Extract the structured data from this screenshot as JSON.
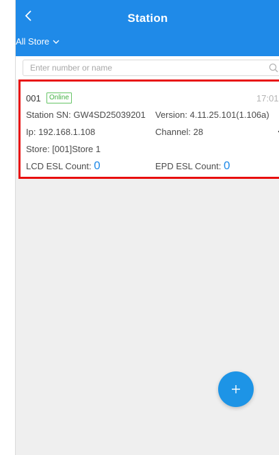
{
  "header": {
    "title": "Station",
    "store_filter": "All Store",
    "colors": {
      "bar": "#1f8ae8"
    }
  },
  "search": {
    "placeholder": "Enter number or name",
    "value": ""
  },
  "stations": [
    {
      "code": "001",
      "status": "Online",
      "time": "17:01",
      "sn_label": "Station SN: GW4SD25039201",
      "version_label": "Version: 4.11.25.101(1.106a)",
      "ip_label": "Ip: 192.168.1.108",
      "channel_label": "Channel: 28",
      "store_label": "Store: [001]Store 1",
      "lcd_label": "LCD ESL Count: ",
      "lcd_count": "0",
      "epd_label": "EPD ESL Count: ",
      "epd_count": "0"
    }
  ],
  "fab": {
    "icon": "plus-icon"
  },
  "icons": {
    "back": "chevron-left-icon",
    "filter": "chevron-down-icon",
    "search": "search-icon",
    "more": "more-icon"
  }
}
